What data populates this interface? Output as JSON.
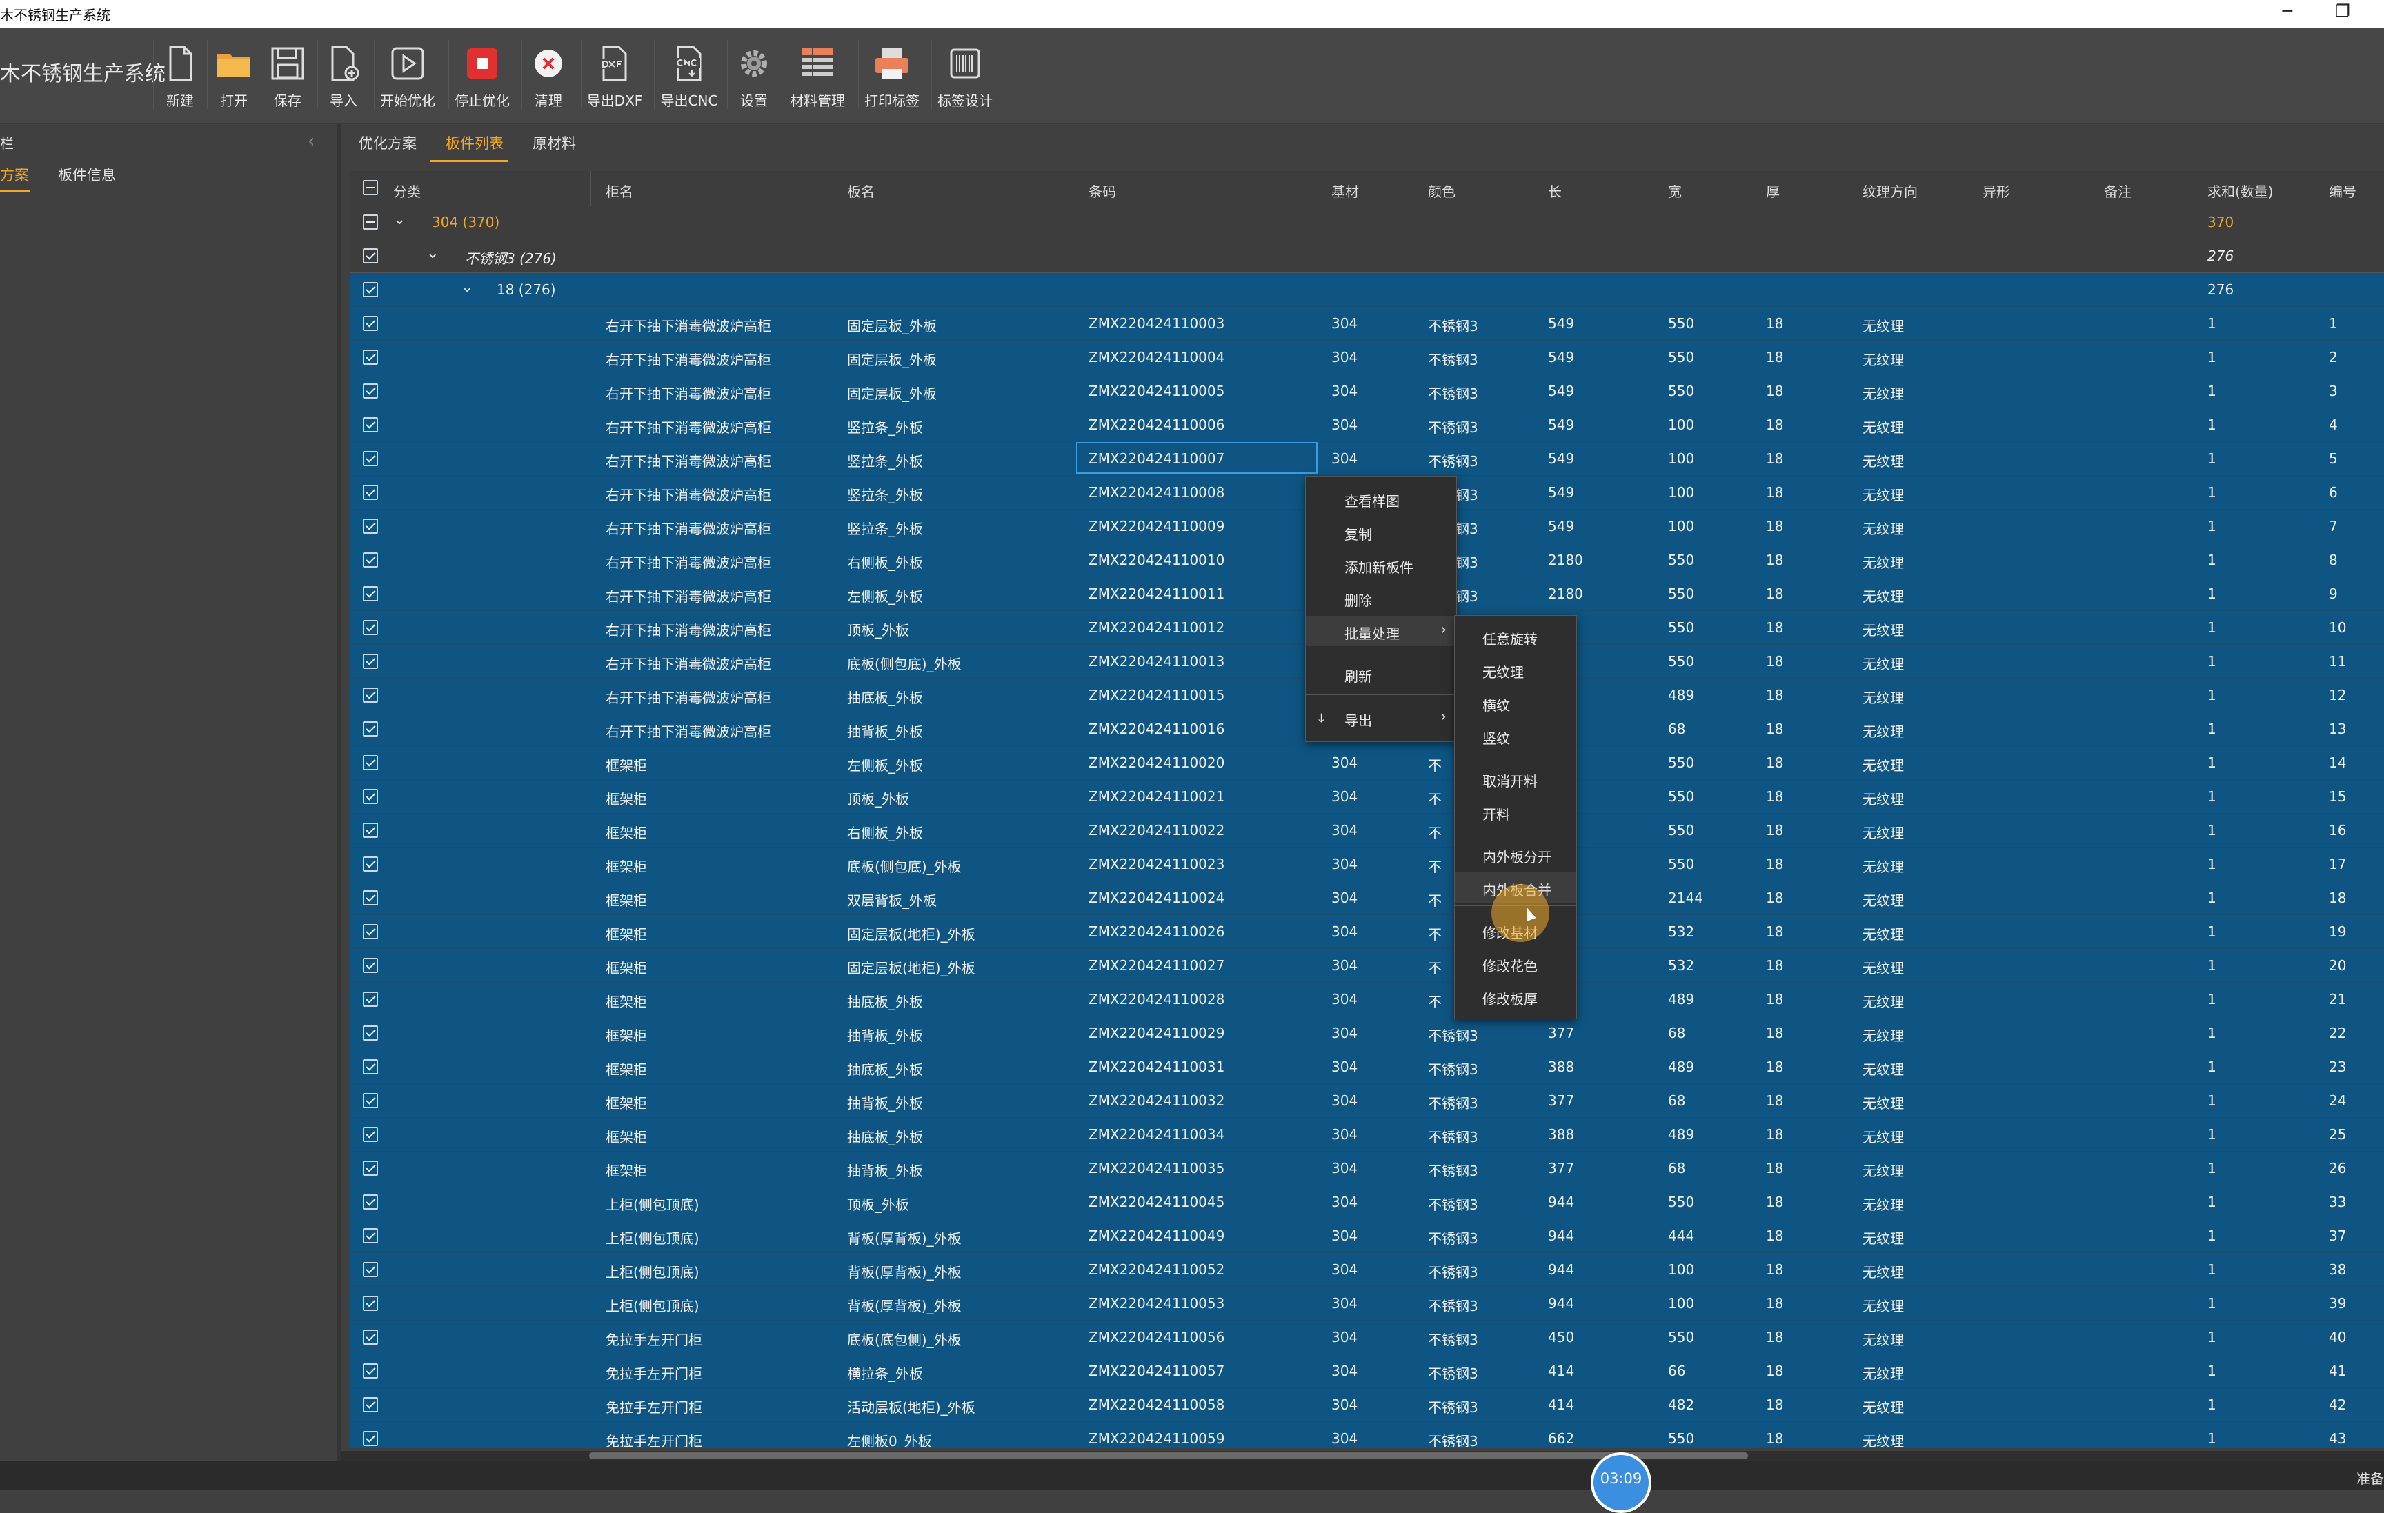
{
  "app": {
    "title": "木不锈钢生产系统",
    "brand": "木不锈钢生产系统"
  },
  "window_controls": {
    "minimize": "─",
    "restore": "❐"
  },
  "toolbar": [
    {
      "label": "新建",
      "icon": "new-file-icon"
    },
    {
      "label": "打开",
      "icon": "open-folder-icon"
    },
    {
      "label": "保存",
      "icon": "save-icon"
    },
    {
      "label": "导入",
      "icon": "import-icon"
    },
    {
      "label": "开始优化",
      "icon": "play-icon"
    },
    {
      "label": "停止优化",
      "icon": "stop-icon"
    },
    {
      "label": "清理",
      "icon": "clear-icon"
    },
    {
      "label": "导出DXF",
      "icon": "export-dxf-icon"
    },
    {
      "label": "导出CNC",
      "icon": "export-cnc-icon"
    },
    {
      "label": "设置",
      "icon": "gear-icon"
    },
    {
      "label": "材料管理",
      "icon": "material-icon"
    },
    {
      "label": "打印标签",
      "icon": "printer-icon"
    },
    {
      "label": "标签设计",
      "icon": "barcode-icon"
    }
  ],
  "sidebar": {
    "title": "栏",
    "collapse_icon": "‹",
    "tabs": [
      {
        "label": "方案",
        "active": true
      },
      {
        "label": "板件信息",
        "active": false
      }
    ]
  },
  "main_tabs": [
    {
      "label": "优化方案",
      "active": false
    },
    {
      "label": "板件列表",
      "active": true
    },
    {
      "label": "原材料",
      "active": false
    }
  ],
  "grid": {
    "headers": [
      "分类",
      "柜名",
      "板名",
      "条码",
      "基材",
      "颜色",
      "长",
      "宽",
      "厚",
      "纹理方向",
      "异形",
      "备注",
      "求和(数量)",
      "编号"
    ],
    "groups": [
      {
        "label": "304 (370)",
        "sum": "370"
      },
      {
        "label": "不锈钢3 (276)",
        "sum": "276"
      },
      {
        "label": "18 (276)",
        "sum": "276"
      }
    ],
    "rows": [
      [
        "右开下抽下消毒微波炉高柜",
        "固定层板_外板",
        "ZMX220424110003",
        "304",
        "不锈钢3",
        "549",
        "550",
        "18",
        "无纹理",
        "1",
        "1"
      ],
      [
        "右开下抽下消毒微波炉高柜",
        "固定层板_外板",
        "ZMX220424110004",
        "304",
        "不锈钢3",
        "549",
        "550",
        "18",
        "无纹理",
        "1",
        "2"
      ],
      [
        "右开下抽下消毒微波炉高柜",
        "固定层板_外板",
        "ZMX220424110005",
        "304",
        "不锈钢3",
        "549",
        "550",
        "18",
        "无纹理",
        "1",
        "3"
      ],
      [
        "右开下抽下消毒微波炉高柜",
        "竖拉条_外板",
        "ZMX220424110006",
        "304",
        "不锈钢3",
        "549",
        "100",
        "18",
        "无纹理",
        "1",
        "4"
      ],
      [
        "右开下抽下消毒微波炉高柜",
        "竖拉条_外板",
        "ZMX220424110007",
        "304",
        "不锈钢3",
        "549",
        "100",
        "18",
        "无纹理",
        "1",
        "5"
      ],
      [
        "右开下抽下消毒微波炉高柜",
        "竖拉条_外板",
        "ZMX220424110008",
        "304",
        "不锈钢3",
        "549",
        "100",
        "18",
        "无纹理",
        "1",
        "6"
      ],
      [
        "右开下抽下消毒微波炉高柜",
        "竖拉条_外板",
        "ZMX220424110009",
        "304",
        "不锈钢3",
        "549",
        "100",
        "18",
        "无纹理",
        "1",
        "7"
      ],
      [
        "右开下抽下消毒微波炉高柜",
        "右侧板_外板",
        "ZMX220424110010",
        "304",
        "不锈钢3",
        "2180",
        "550",
        "18",
        "无纹理",
        "1",
        "8"
      ],
      [
        "右开下抽下消毒微波炉高柜",
        "左侧板_外板",
        "ZMX220424110011",
        "304",
        "不锈钢3",
        "2180",
        "550",
        "18",
        "无纹理",
        "1",
        "9"
      ],
      [
        "右开下抽下消毒微波炉高柜",
        "顶板_外板",
        "ZMX220424110012",
        "304",
        "",
        "",
        "550",
        "18",
        "无纹理",
        "1",
        "10"
      ],
      [
        "右开下抽下消毒微波炉高柜",
        "底板(侧包底)_外板",
        "ZMX220424110013",
        "304",
        "",
        "",
        "550",
        "18",
        "无纹理",
        "1",
        "11"
      ],
      [
        "右开下抽下消毒微波炉高柜",
        "抽底板_外板",
        "ZMX220424110015",
        "304",
        "",
        "",
        "489",
        "18",
        "无纹理",
        "1",
        "12"
      ],
      [
        "右开下抽下消毒微波炉高柜",
        "抽背板_外板",
        "ZMX220424110016",
        "",
        "",
        "",
        "68",
        "18",
        "无纹理",
        "1",
        "13"
      ],
      [
        "框架柜",
        "左侧板_外板",
        "ZMX220424110020",
        "304",
        "不",
        "",
        "550",
        "18",
        "无纹理",
        "1",
        "14"
      ],
      [
        "框架柜",
        "顶板_外板",
        "ZMX220424110021",
        "304",
        "不",
        "",
        "550",
        "18",
        "无纹理",
        "1",
        "15"
      ],
      [
        "框架柜",
        "右侧板_外板",
        "ZMX220424110022",
        "304",
        "不",
        "",
        "550",
        "18",
        "无纹理",
        "1",
        "16"
      ],
      [
        "框架柜",
        "底板(侧包底)_外板",
        "ZMX220424110023",
        "304",
        "不",
        "",
        "550",
        "18",
        "无纹理",
        "1",
        "17"
      ],
      [
        "框架柜",
        "双层背板_外板",
        "ZMX220424110024",
        "304",
        "不",
        "",
        "2144",
        "18",
        "无纹理",
        "1",
        "18"
      ],
      [
        "框架柜",
        "固定层板(地柜)_外板",
        "ZMX220424110026",
        "304",
        "不",
        "",
        "532",
        "18",
        "无纹理",
        "1",
        "19"
      ],
      [
        "框架柜",
        "固定层板(地柜)_外板",
        "ZMX220424110027",
        "304",
        "不",
        "",
        "532",
        "18",
        "无纹理",
        "1",
        "20"
      ],
      [
        "框架柜",
        "抽底板_外板",
        "ZMX220424110028",
        "304",
        "不",
        "",
        "489",
        "18",
        "无纹理",
        "1",
        "21"
      ],
      [
        "框架柜",
        "抽背板_外板",
        "ZMX220424110029",
        "304",
        "不锈钢3",
        "377",
        "68",
        "18",
        "无纹理",
        "1",
        "22"
      ],
      [
        "框架柜",
        "抽底板_外板",
        "ZMX220424110031",
        "304",
        "不锈钢3",
        "388",
        "489",
        "18",
        "无纹理",
        "1",
        "23"
      ],
      [
        "框架柜",
        "抽背板_外板",
        "ZMX220424110032",
        "304",
        "不锈钢3",
        "377",
        "68",
        "18",
        "无纹理",
        "1",
        "24"
      ],
      [
        "框架柜",
        "抽底板_外板",
        "ZMX220424110034",
        "304",
        "不锈钢3",
        "388",
        "489",
        "18",
        "无纹理",
        "1",
        "25"
      ],
      [
        "框架柜",
        "抽背板_外板",
        "ZMX220424110035",
        "304",
        "不锈钢3",
        "377",
        "68",
        "18",
        "无纹理",
        "1",
        "26"
      ],
      [
        "上柜(侧包顶底)",
        "顶板_外板",
        "ZMX220424110045",
        "304",
        "不锈钢3",
        "944",
        "550",
        "18",
        "无纹理",
        "1",
        "33"
      ],
      [
        "上柜(侧包顶底)",
        "背板(厚背板)_外板",
        "ZMX220424110049",
        "304",
        "不锈钢3",
        "944",
        "444",
        "18",
        "无纹理",
        "1",
        "37"
      ],
      [
        "上柜(侧包顶底)",
        "背板(厚背板)_外板",
        "ZMX220424110052",
        "304",
        "不锈钢3",
        "944",
        "100",
        "18",
        "无纹理",
        "1",
        "38"
      ],
      [
        "上柜(侧包顶底)",
        "背板(厚背板)_外板",
        "ZMX220424110053",
        "304",
        "不锈钢3",
        "944",
        "100",
        "18",
        "无纹理",
        "1",
        "39"
      ],
      [
        "免拉手左开门柜",
        "底板(底包侧)_外板",
        "ZMX220424110056",
        "304",
        "不锈钢3",
        "450",
        "550",
        "18",
        "无纹理",
        "1",
        "40"
      ],
      [
        "免拉手左开门柜",
        "横拉条_外板",
        "ZMX220424110057",
        "304",
        "不锈钢3",
        "414",
        "66",
        "18",
        "无纹理",
        "1",
        "41"
      ],
      [
        "免拉手左开门柜",
        "活动层板(地柜)_外板",
        "ZMX220424110058",
        "304",
        "不锈钢3",
        "414",
        "482",
        "18",
        "无纹理",
        "1",
        "42"
      ],
      [
        "免拉手左开门柜",
        "左侧板0_外板",
        "ZMX220424110059",
        "304",
        "不锈钢3",
        "662",
        "550",
        "18",
        "无纹理",
        "1",
        "43"
      ]
    ]
  },
  "context_menu": {
    "items": [
      {
        "label": "查看样图"
      },
      {
        "label": "复制"
      },
      {
        "label": "添加新板件"
      },
      {
        "label": "删除"
      },
      {
        "label": "批量处理",
        "submenu": true
      },
      {
        "label": "刷新"
      },
      {
        "label": "导出",
        "submenu": true,
        "icon": "⤓"
      }
    ],
    "submenu_arrow": "›"
  },
  "batch_submenu": [
    "任意旋转",
    "无纹理",
    "横纹",
    "竖纹",
    "取消开料",
    "开料",
    "内外板分开",
    "内外板合并",
    "修改基材",
    "修改花色",
    "修改板厚"
  ],
  "status": {
    "text": "准备",
    "timer": "03:09"
  },
  "colors": {
    "accent": "#f5a623",
    "row_selected": "#0e5583",
    "toolbar": "#474747"
  }
}
